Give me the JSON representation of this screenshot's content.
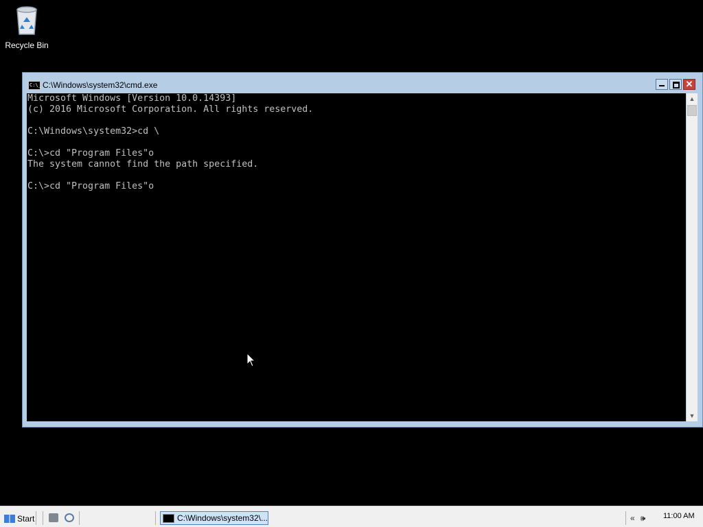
{
  "desktop": {
    "icons": [
      {
        "label": "Recycle Bin",
        "icon": "recycle-bin-icon"
      }
    ]
  },
  "window": {
    "title": "C:\\Windows\\system32\\cmd.exe",
    "buttons": {
      "minimize": "minimize",
      "maximize": "maximize",
      "close": "✕"
    },
    "console_text": "Microsoft Windows [Version 10.0.14393]\n(c) 2016 Microsoft Corporation. All rights reserved.\n\nC:\\Windows\\system32>cd \\\n\nC:\\>cd \"Program Files\"o\nThe system cannot find the path specified.\n\nC:\\>cd \"Program Files\"o"
  },
  "taskbar": {
    "start_label": "Start",
    "task_buttons": [
      {
        "label": "C:\\Windows\\system32\\...",
        "icon": "cmd-icon"
      }
    ],
    "tray": {
      "expand": "«",
      "volume": "🕪"
    },
    "clock": "11:00 AM"
  },
  "colors": {
    "console_bg": "#000000",
    "console_fg": "#c0c0c0",
    "window_frame": "#b6cde6",
    "close_button": "#c7433a"
  }
}
